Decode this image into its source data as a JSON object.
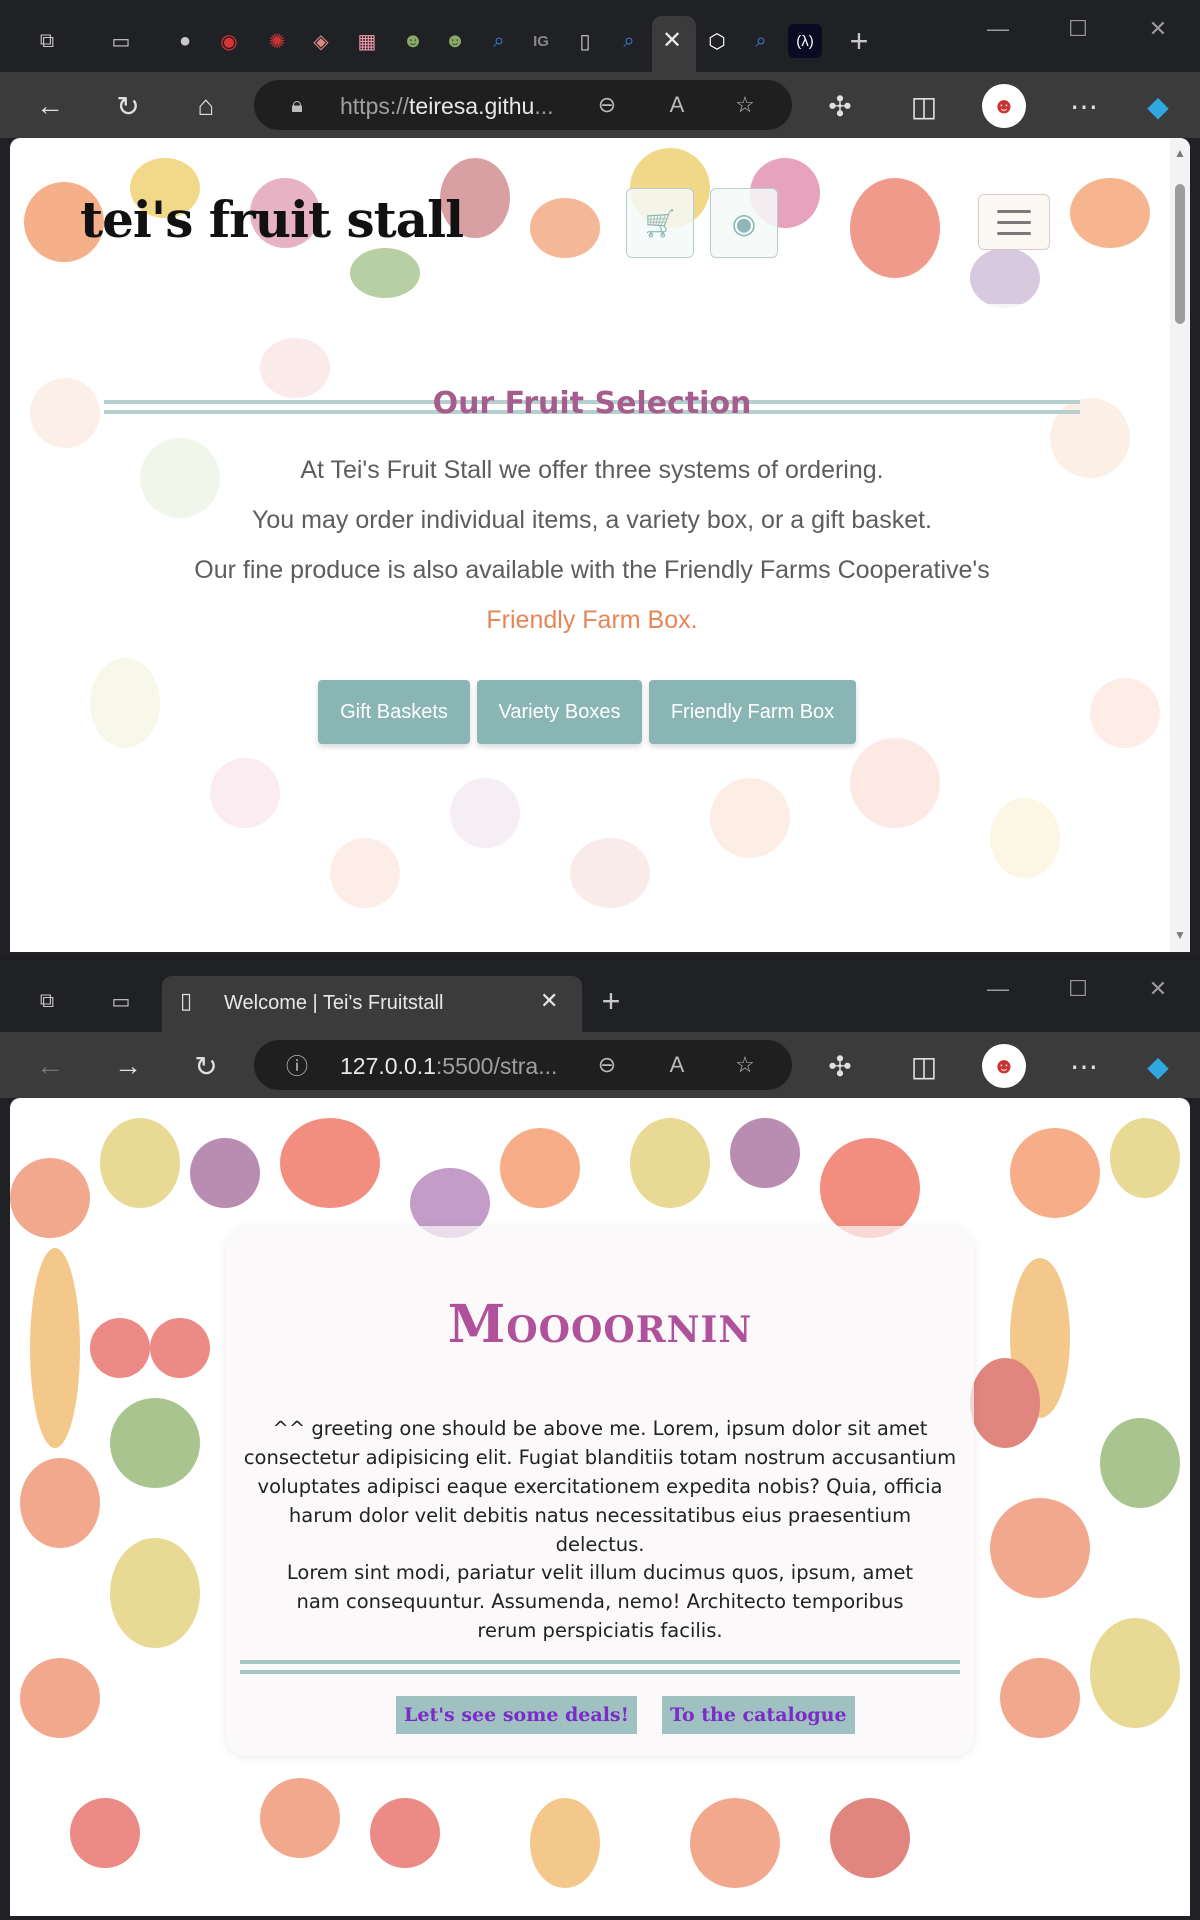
{
  "colors": {
    "chrome_dark": "#202124",
    "chrome_toolbar": "#3b3b3b",
    "teal_button": "#89b6b5",
    "title_mauve": "#a65c8c",
    "link_orange": "#e88557",
    "card_title_pink": "#b0519b",
    "card_button_text": "#7b2cc7"
  },
  "window1": {
    "tabs": {
      "icons": [
        "workspaces-icon",
        "tab-actions-icon",
        "github-icon",
        "edge-red-icon",
        "red-logo-icon",
        "dark-logo-icon",
        "colorful-app-icon",
        "owl-icon",
        "owl-icon-2",
        "search-icon",
        "ig-icon",
        "page-icon",
        "search-icon-2",
        "close-icon",
        "codepen-icon",
        "search-icon-3",
        "lambda-icon",
        "new-tab-icon"
      ]
    },
    "address": {
      "scheme": "https://",
      "host": "teiresa.githu",
      "ellipsis": "..."
    },
    "site": {
      "logo": "tei's fruit stall",
      "section_title": "Our Fruit Selection",
      "lines": [
        "At Tei's Fruit Stall we offer three systems of ordering.",
        "You may order individual items, a variety box, or a gift basket.",
        "Our fine produce is also available with the Friendly Farms Cooperative's"
      ],
      "link": "Friendly Farm Box.",
      "buttons": [
        "Gift Baskets",
        "Variety Boxes",
        "Friendly Farm Box"
      ]
    }
  },
  "window2": {
    "tab_title": "Welcome | Tei's Fruitstall",
    "address": {
      "host": "127.0.0.1",
      "rest": ":5500/stra..."
    },
    "card": {
      "title": "Moooornin",
      "p1": "^^ greeting one should be above me. Lorem, ipsum dolor sit amet consectetur adipisicing elit. Fugiat blanditiis totam nostrum accusantium voluptates adipisci eaque exercitationem expedita nobis? Quia, officia harum dolor velit debitis natus necessitatibus eius praesentium delectus.",
      "p2": "Lorem sint modi, pariatur velit illum ducimus quos, ipsum, amet nam consequuntur. Assumenda, nemo! Architecto temporibus rerum perspiciatis facilis.",
      "buttons": [
        "Let's see some deals!",
        "To the catalogue"
      ]
    }
  }
}
